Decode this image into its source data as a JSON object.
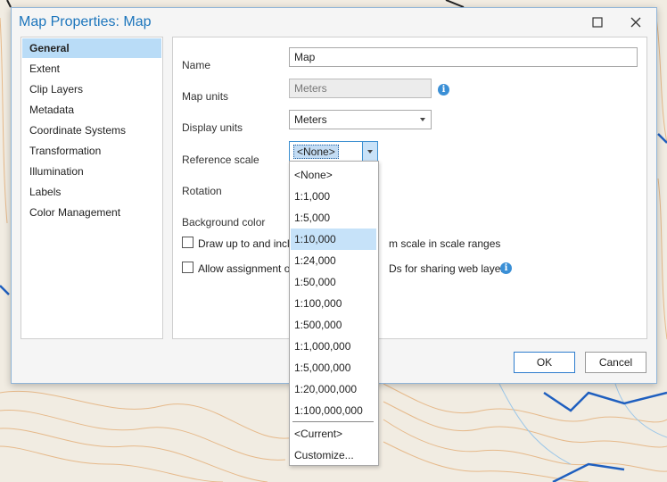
{
  "dialog": {
    "title": "Map Properties: Map",
    "buttons": {
      "ok": "OK",
      "cancel": "Cancel"
    }
  },
  "nav": {
    "items": [
      {
        "label": "General"
      },
      {
        "label": "Extent"
      },
      {
        "label": "Clip Layers"
      },
      {
        "label": "Metadata"
      },
      {
        "label": "Coordinate Systems"
      },
      {
        "label": "Transformation"
      },
      {
        "label": "Illumination"
      },
      {
        "label": "Labels"
      },
      {
        "label": "Color Management"
      }
    ],
    "selected": "General"
  },
  "general": {
    "name_label": "Name",
    "name_value": "Map",
    "map_units_label": "Map units",
    "map_units_value": "Meters",
    "display_units_label": "Display units",
    "display_units_value": "Meters",
    "reference_scale_label": "Reference scale",
    "reference_scale_value": "<None>",
    "rotation_label": "Rotation",
    "background_color_label": "Background color",
    "checkbox1_label_visible_left": "Draw up to and incl",
    "checkbox1_label_visible_right": "m scale in scale ranges",
    "checkbox2_label_visible_left": "Allow assignment o",
    "checkbox2_label_visible_right": "Ds for sharing web layers"
  },
  "dropdown": {
    "items": [
      "<None>",
      "1:1,000",
      "1:5,000",
      "1:10,000",
      "1:24,000",
      "1:50,000",
      "1:100,000",
      "1:500,000",
      "1:1,000,000",
      "1:5,000,000",
      "1:20,000,000",
      "1:100,000,000"
    ],
    "extra_items": [
      "<Current>",
      "Customize..."
    ],
    "highlighted": "1:10,000"
  },
  "colors": {
    "accent": "#1c75bc",
    "selection": "#b9dcf7",
    "map_background": "#f1ece2",
    "contour": "#e6b98a",
    "water": "#1f5fbf"
  },
  "icons": {
    "info": "info-icon",
    "minimize": "maximize-icon",
    "close": "close-icon"
  }
}
